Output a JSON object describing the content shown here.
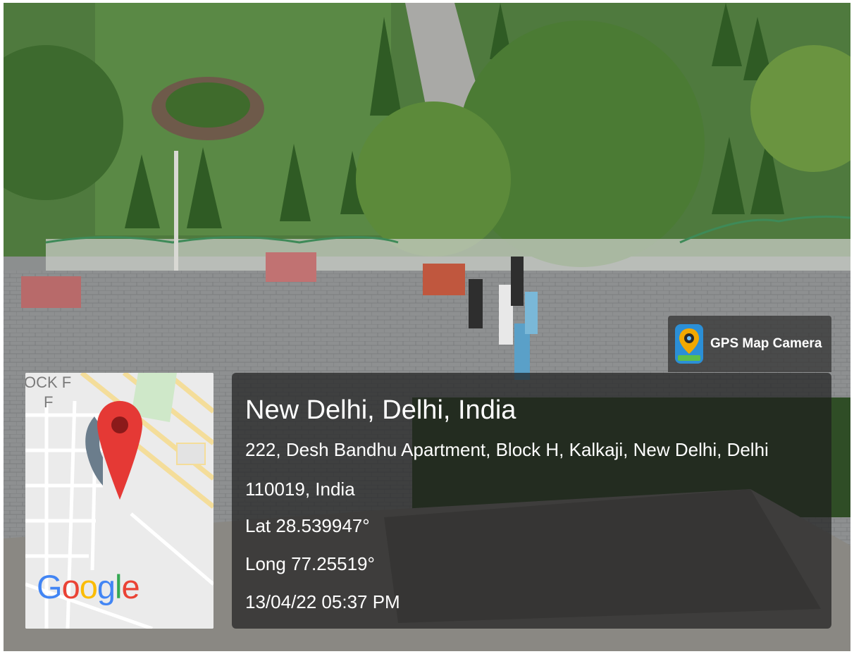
{
  "app": {
    "name": "GPS Map Camera",
    "icon": "gps-map-camera-app-icon",
    "accent": "#f2a800"
  },
  "map": {
    "label_lines": [
      "OCK F",
      "F"
    ],
    "logo_text": "Google",
    "logo_colors": [
      "#4285F4",
      "#EA4335",
      "#FBBC05",
      "#4285F4",
      "#34A853",
      "#EA4335"
    ],
    "pin_icon": "map-pin-icon",
    "pin_color": "#e53935"
  },
  "location": {
    "city": "New Delhi, Delhi, India",
    "address_line1": "222, Desh Bandhu Apartment, Block H, Kalkaji, New Delhi, Delhi",
    "address_line2": "110019, India",
    "latitude": "Lat 28.539947°",
    "longitude": "Long 77.25519°",
    "timestamp": "13/04/22 05:37 PM"
  }
}
